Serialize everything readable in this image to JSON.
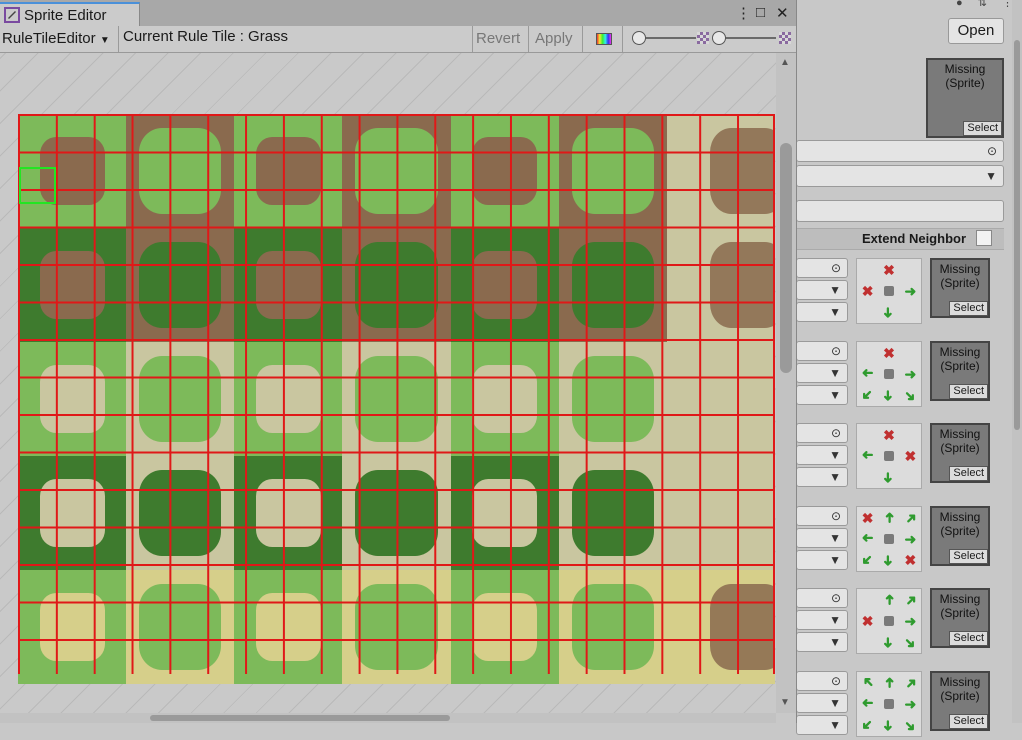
{
  "window": {
    "tab_title": "Sprite Editor",
    "controls": [
      "⋮",
      "□",
      "✕"
    ]
  },
  "toolbar": {
    "mode_dropdown": "RuleTileEditor",
    "current_tile_label": "Current Rule Tile : Grass",
    "revert_label": "Revert",
    "apply_label": "Apply"
  },
  "inspector": {
    "open_label": "Open",
    "default_sprite": {
      "label": "Missing (Sprite)",
      "select": "Select"
    },
    "extend_neighbor_label": "Extend Neighbor",
    "rules": [
      {
        "sprite": "Missing (Sprite)",
        "select": "Select",
        "grid": [
          "",
          "x",
          "",
          "x",
          "c",
          "a",
          "",
          "a",
          ""
        ]
      },
      {
        "sprite": "Missing (Sprite)",
        "select": "Select",
        "grid": [
          "",
          "x",
          "",
          "a",
          "c",
          "a",
          "a",
          "a",
          "a"
        ]
      },
      {
        "sprite": "Missing (Sprite)",
        "select": "Select",
        "grid": [
          "",
          "x",
          "",
          "a",
          "c",
          "x",
          "",
          "a",
          ""
        ]
      },
      {
        "sprite": "Missing (Sprite)",
        "select": "Select",
        "grid": [
          "x",
          "a",
          "a",
          "a",
          "c",
          "a",
          "a",
          "a",
          "x"
        ]
      },
      {
        "sprite": "Missing (Sprite)",
        "select": "Select",
        "grid": [
          "",
          "a",
          "a",
          "x",
          "c",
          "a",
          "",
          "a",
          "a"
        ]
      },
      {
        "sprite": "Missing (Sprite)",
        "select": "Select",
        "grid": [
          "a",
          "a",
          "a",
          "a",
          "c",
          "a",
          "a",
          "a",
          "a"
        ]
      }
    ]
  },
  "colors": {
    "grid_line": "#e01818",
    "selection": "#22e622",
    "grass_light": "#7dba5a",
    "grass_dark": "#3e7b2e",
    "dirt": "#8a6a4e",
    "sand_light": "#c9c6a0",
    "sand_yellow": "#d6cf8a"
  }
}
